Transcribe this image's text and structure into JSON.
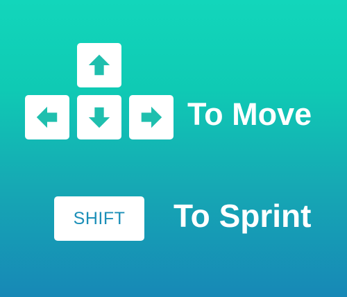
{
  "controls": {
    "move_label": "To Move",
    "sprint_label": "To Sprint",
    "shift_key_label": "SHIFT",
    "arrow_keys": [
      {
        "direction": "up",
        "icon": "arrow-up-icon"
      },
      {
        "direction": "left",
        "icon": "arrow-left-icon"
      },
      {
        "direction": "down",
        "icon": "arrow-down-icon"
      },
      {
        "direction": "right",
        "icon": "arrow-right-icon"
      }
    ]
  },
  "colors": {
    "background_top": "#12d6bb",
    "background_bottom": "#1788b6",
    "key_face": "#ffffff",
    "arrow_color": "#1fbfae",
    "shift_text_color": "#1b8fb8",
    "label_color": "#ffffff"
  }
}
